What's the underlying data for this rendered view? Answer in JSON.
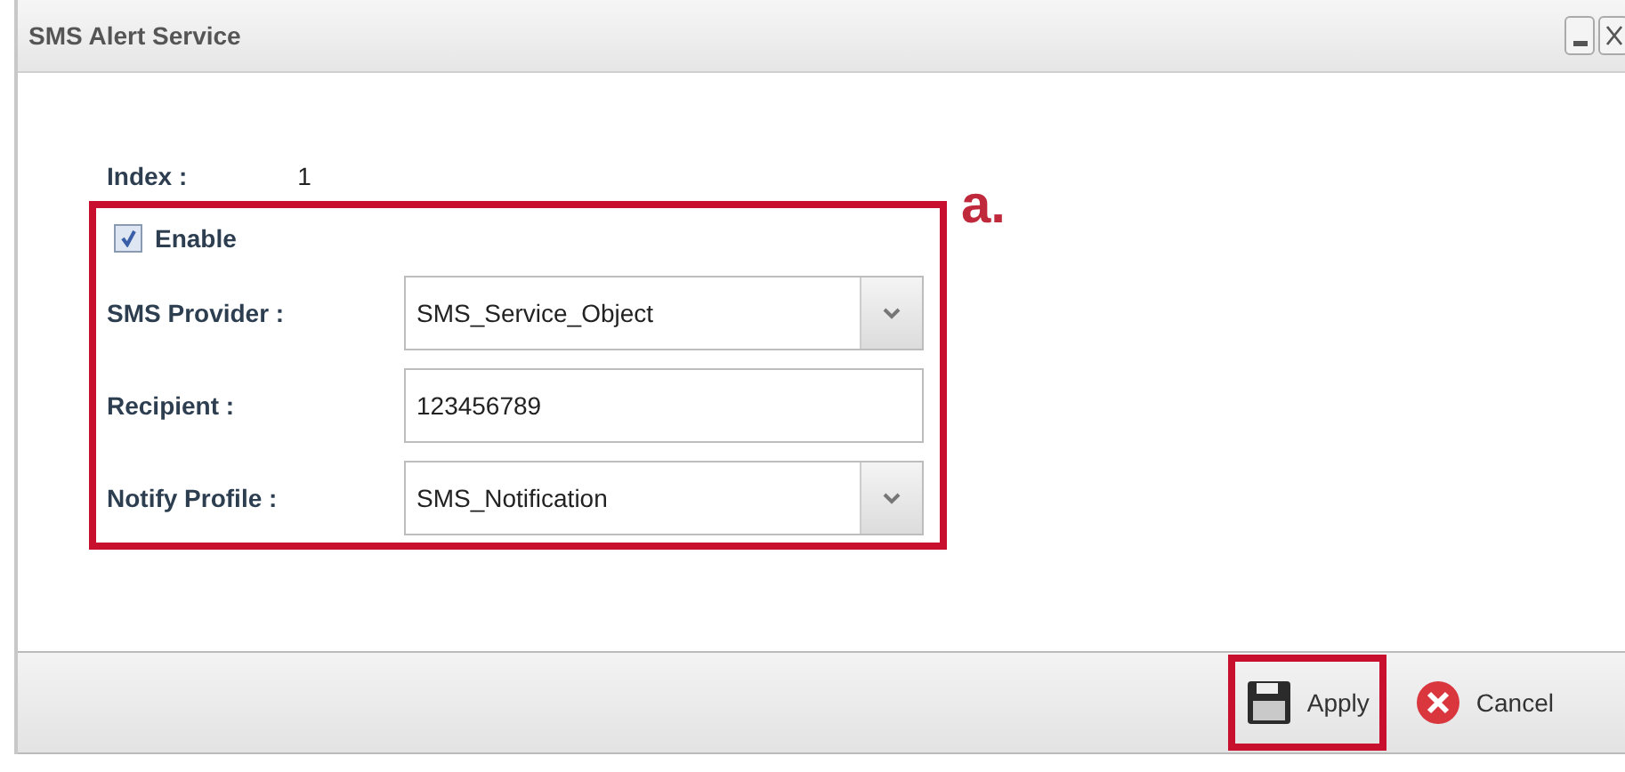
{
  "window": {
    "title": "SMS Alert Service",
    "controls": [
      {
        "kind": "minimize"
      },
      {
        "kind": "close"
      }
    ]
  },
  "index": {
    "label": "Index :",
    "value": "1"
  },
  "enable": {
    "label": "Enable",
    "checked": true
  },
  "fields": [
    {
      "kind": "select",
      "label": "SMS Provider :",
      "value": "SMS_Service_Object"
    },
    {
      "kind": "text",
      "label": "Recipient :",
      "value": "123456789"
    },
    {
      "kind": "select",
      "label": "Notify Profile :",
      "value": "SMS_Notification"
    }
  ],
  "annotation": {
    "label": "a.",
    "highlighted": true
  },
  "buttons": [
    {
      "kind": "apply",
      "label": "Apply",
      "highlighted": true
    },
    {
      "kind": "cancel",
      "label": "Cancel",
      "highlighted": false
    }
  ]
}
